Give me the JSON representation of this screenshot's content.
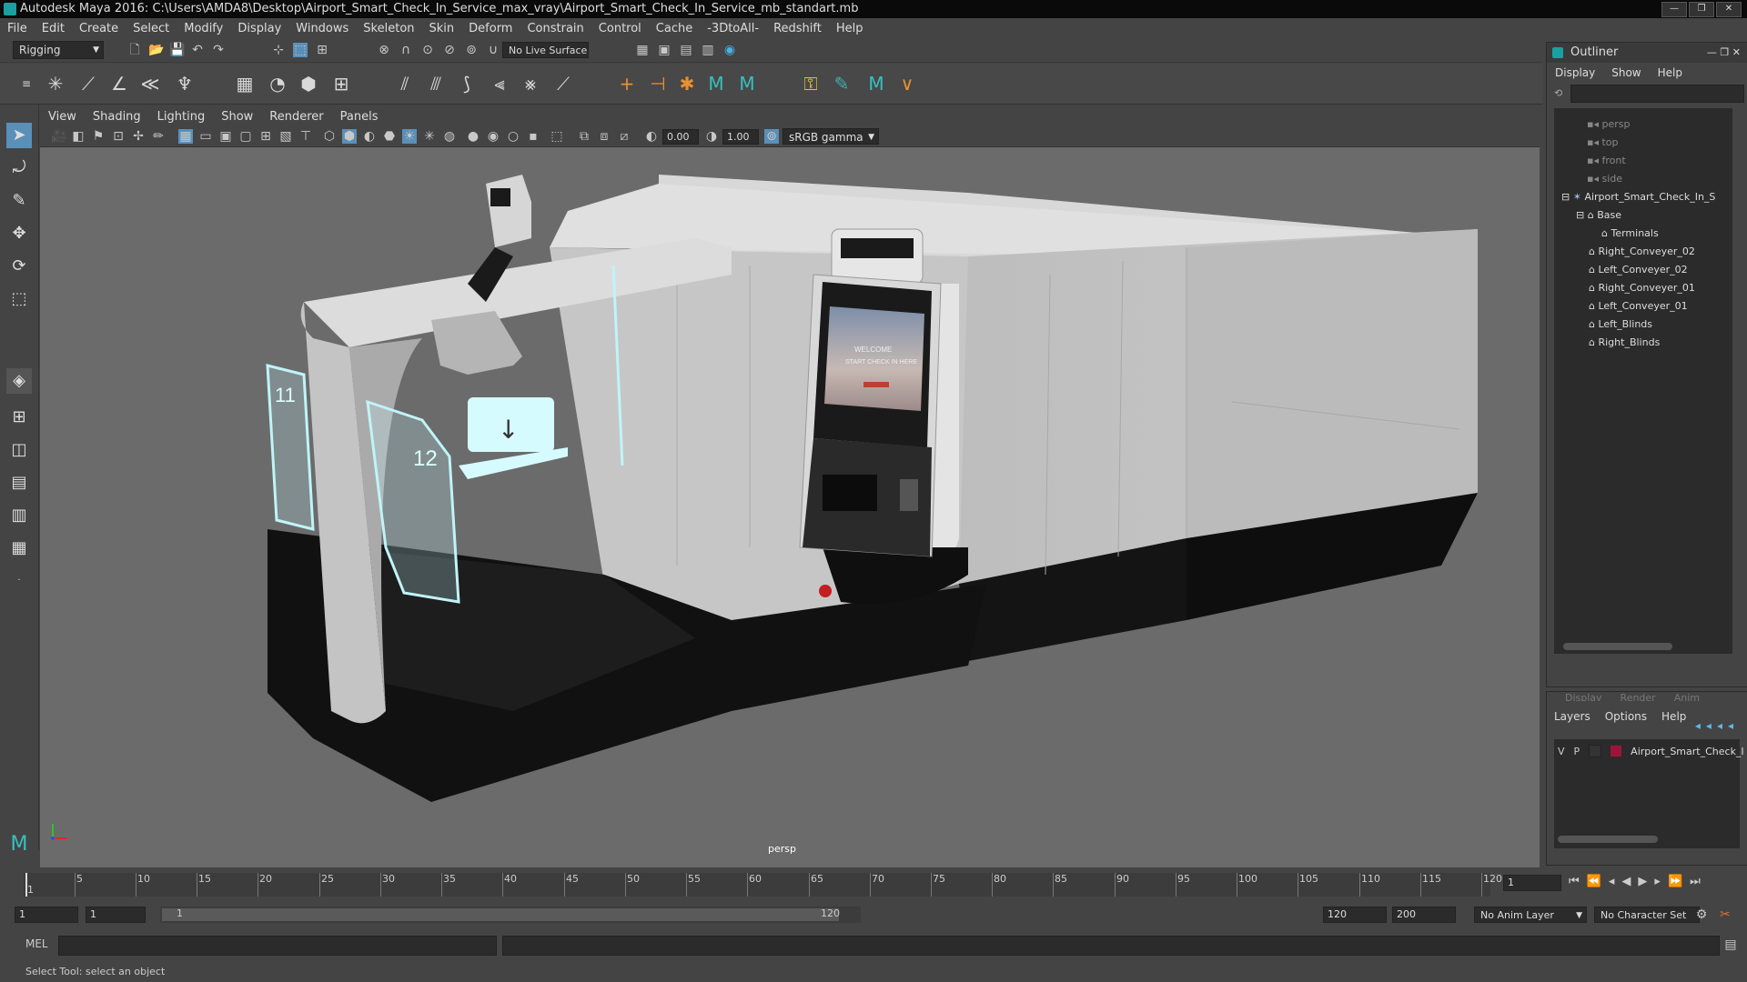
{
  "window": {
    "title": "Autodesk Maya 2016: C:\\Users\\AMDA8\\Desktop\\Airport_Smart_Check_In_Service_max_vray\\Airport_Smart_Check_In_Service_mb_standart.mb"
  },
  "menubar": [
    "File",
    "Edit",
    "Create",
    "Select",
    "Modify",
    "Display",
    "Windows",
    "Skeleton",
    "Skin",
    "Deform",
    "Constrain",
    "Control",
    "Cache",
    "-3DtoAll-",
    "Redshift",
    "Help"
  ],
  "statusline": {
    "menuset": "Rigging",
    "live_surface": "No Live Surface"
  },
  "viewport": {
    "menu": [
      "View",
      "Shading",
      "Lighting",
      "Show",
      "Renderer",
      "Panels"
    ],
    "exposure": "0.00",
    "gamma": "1.00",
    "color_space": "sRGB gamma",
    "camera_label": "persp",
    "gate_numbers": [
      "11",
      "12"
    ],
    "kiosk_screen": {
      "line1": "WELCOME",
      "line2": "START CHECK IN HERE"
    }
  },
  "outliner": {
    "title": "Outliner",
    "menu": [
      "Display",
      "Show",
      "Help"
    ],
    "items": [
      {
        "label": "persp",
        "indent": 2,
        "dim": true,
        "icon": "camera"
      },
      {
        "label": "top",
        "indent": 2,
        "dim": true,
        "icon": "camera"
      },
      {
        "label": "front",
        "indent": 2,
        "dim": true,
        "icon": "camera"
      },
      {
        "label": "side",
        "indent": 2,
        "dim": true,
        "icon": "camera"
      },
      {
        "label": "Airport_Smart_Check_In_S",
        "indent": 1,
        "dim": false,
        "icon": "joint"
      },
      {
        "label": "Base",
        "indent": 2,
        "dim": false,
        "icon": "mesh"
      },
      {
        "label": "Terminals",
        "indent": 3,
        "dim": false,
        "icon": "mesh"
      },
      {
        "label": "Right_Conveyer_02",
        "indent": 2,
        "dim": false,
        "icon": "mesh"
      },
      {
        "label": "Left_Conveyer_02",
        "indent": 2,
        "dim": false,
        "icon": "mesh"
      },
      {
        "label": "Right_Conveyer_01",
        "indent": 2,
        "dim": false,
        "icon": "mesh"
      },
      {
        "label": "Left_Conveyer_01",
        "indent": 2,
        "dim": false,
        "icon": "mesh"
      },
      {
        "label": "Left_Blinds",
        "indent": 2,
        "dim": false,
        "icon": "mesh"
      },
      {
        "label": "Right_Blinds",
        "indent": 2,
        "dim": false,
        "icon": "mesh"
      }
    ]
  },
  "layer_editor": {
    "tabs": [
      "Display",
      "Render",
      "Anim"
    ],
    "menu": [
      "Layers",
      "Options",
      "Help"
    ],
    "layer": {
      "v": "V",
      "p": "P",
      "name": "Airport_Smart_Check_I",
      "color": "#a0143c"
    }
  },
  "timeline": {
    "ticks": [
      "1",
      "5",
      "10",
      "15",
      "20",
      "25",
      "30",
      "35",
      "40",
      "45",
      "50",
      "55",
      "60",
      "65",
      "70",
      "75",
      "80",
      "85",
      "90",
      "95",
      "100",
      "105",
      "110",
      "115",
      "120"
    ],
    "current_frame": "1"
  },
  "range": {
    "start": "1",
    "playback_start": "1",
    "slider_start": "1",
    "slider_end": "120",
    "playback_end": "120",
    "end": "200",
    "anim_layer": "No Anim Layer",
    "character_set": "No Character Set"
  },
  "cmdline": {
    "label": "MEL"
  },
  "helpline": {
    "text": "Select Tool: select an object"
  }
}
